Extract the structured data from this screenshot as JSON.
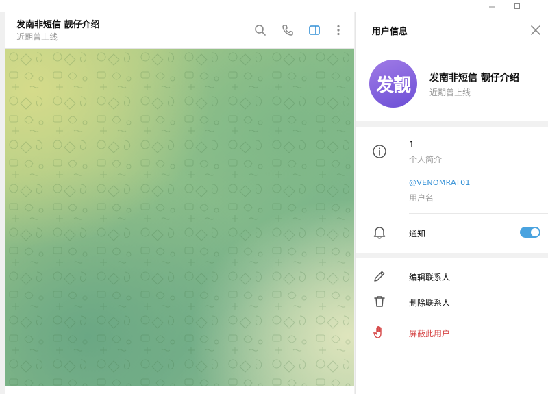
{
  "window": {
    "controls": [
      {
        "name": "minimize-icon"
      },
      {
        "name": "maximize-icon"
      }
    ]
  },
  "chat": {
    "title": "发南非短信 靓仔介绍",
    "status": "近期曾上线",
    "header_icons": [
      "search-icon",
      "phone-icon",
      "sidebar-toggle-icon",
      "more-vertical-icon"
    ],
    "accent": "#3390d6"
  },
  "panel": {
    "title": "用户信息",
    "avatar_text": "发靓",
    "name": "发南非短信 靓仔介绍",
    "status": "近期曾上线",
    "bio_value": "1",
    "bio_label": "个人简介",
    "username_value": "@VENOMRAT01",
    "username_label": "用户名",
    "notifications_label": "通知",
    "notifications_on": true,
    "actions": [
      {
        "label": "编辑联系人",
        "icon": "pencil-icon"
      },
      {
        "label": "删除联系人",
        "icon": "trash-icon"
      },
      {
        "label": "屏蔽此用户",
        "icon": "block-hand-icon",
        "color": "#d64848"
      }
    ]
  }
}
